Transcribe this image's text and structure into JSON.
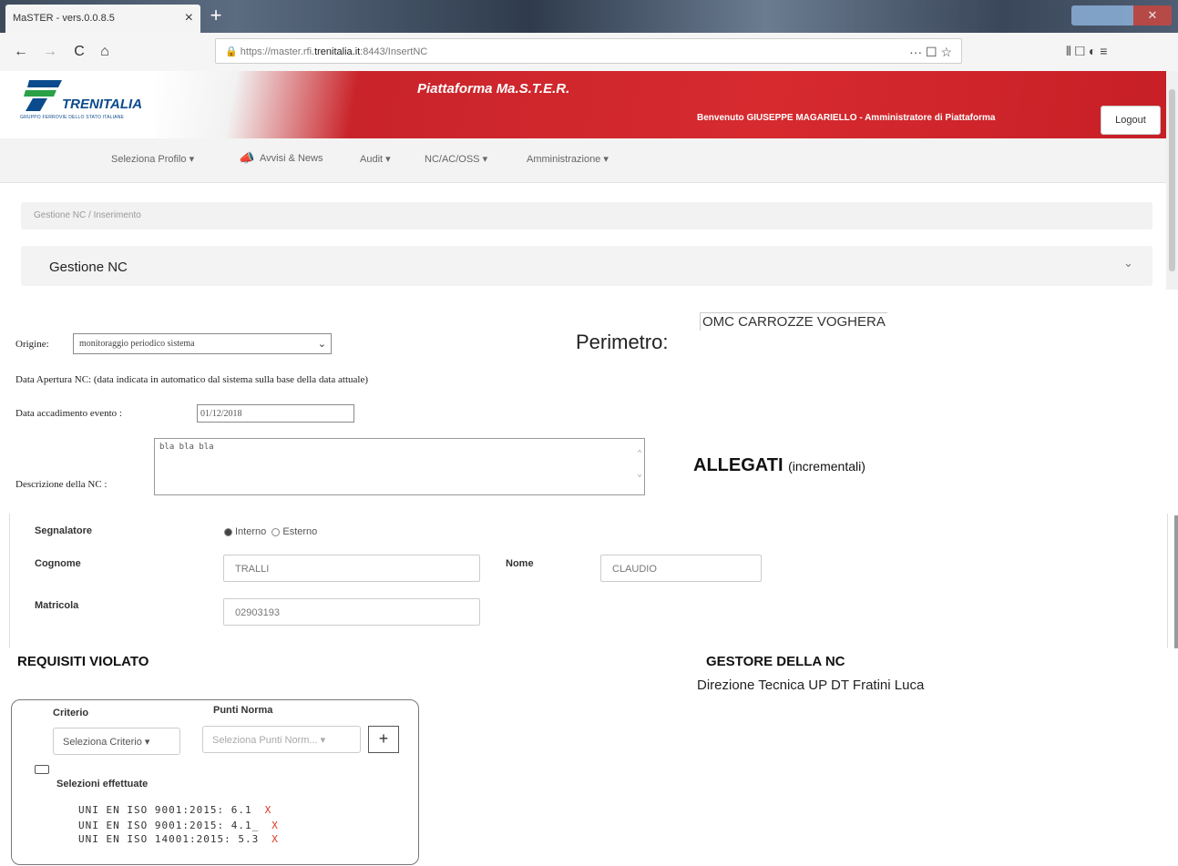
{
  "browser": {
    "tab_title": "MaSTER - vers.0.0.8.5",
    "tab_close": "×",
    "new_tab": "+",
    "url_prefix": "https://master.rfi.",
    "url_host": "trenitalia.it",
    "url_suffix": ":8443/InsertNC",
    "nav_back": "←",
    "nav_forward": "→",
    "nav_reload": "C",
    "nav_home": "⌂",
    "url_icons": "··· ☐ ☆",
    "right_icons": "⫴ ☐ ◐ ≡",
    "win_close": "✕"
  },
  "header": {
    "logo_text": "TRENITALIA",
    "logo_sub": "GRUPPO FERROVIE DELLO STATO ITALIANE",
    "platform_title": "Piattaforma Ma.S.T.E.R.",
    "welcome": "Benvenuto GIUSEPPE MAGARIELLO - Amministratore di Piattaforma",
    "logout_label": "Logout"
  },
  "menu": {
    "items": [
      "Seleziona Profilo ▾",
      "Avvisi & News",
      "Audit ▾",
      "NC/AC/OSS ▾",
      "Amministrazione ▾"
    ]
  },
  "breadcrumb": "Gestione NC  /  Inserimento",
  "panel": {
    "title": "Gestione  NC",
    "chevron": "⌄"
  },
  "form": {
    "origine_label": "Origine:",
    "origine_value": "monitoraggio periodico sistema",
    "data_apertura_label": "Data Apertura NC: (data indicata in automatico dal sistema sulla base della data attuale)",
    "data_evento_label": "Data accadimento evento :",
    "data_evento_value": "01/12/2018",
    "descrizione_label": "Descrizione della NC :",
    "descrizione_value": "bla bla bla",
    "perimetro_label": "Perimetro:",
    "perimetro_value": "OMC CARROZZE VOGHERA",
    "allegati_label": "ALLEGATI",
    "allegati_note": "(incrementali)"
  },
  "segnalatore": {
    "label": "Segnalatore",
    "radio_interno": "Interno",
    "radio_esterno": "Esterno",
    "cognome_label": "Cognome",
    "cognome_value": "TRALLI",
    "nome_label": "Nome",
    "nome_value": "CLAUDIO",
    "matricola_label": "Matricola",
    "matricola_value": "02903193"
  },
  "requisiti": {
    "title": "REQUISITI VIOLATO",
    "criterio_label": "Criterio",
    "criterio_button": "Seleziona Criterio ▾",
    "punti_label": "Punti Norma",
    "punti_button": "Seleziona Punti Norm... ▾",
    "add_label": "+",
    "selezioni_label": "Selezioni  effettuate",
    "selezioni": [
      {
        "text": "UNI EN ISO 9001:2015: 6.1",
        "remove": "X"
      },
      {
        "text": "UNI EN ISO 9001:2015: 4.1_",
        "remove": "X"
      },
      {
        "text": "UNI EN ISO 14001:2015: 5.3",
        "remove": "X"
      }
    ]
  },
  "gestore": {
    "title": "GESTORE DELLA NC",
    "value": "Direzione Tecnica UP DT  Fratini Luca"
  }
}
